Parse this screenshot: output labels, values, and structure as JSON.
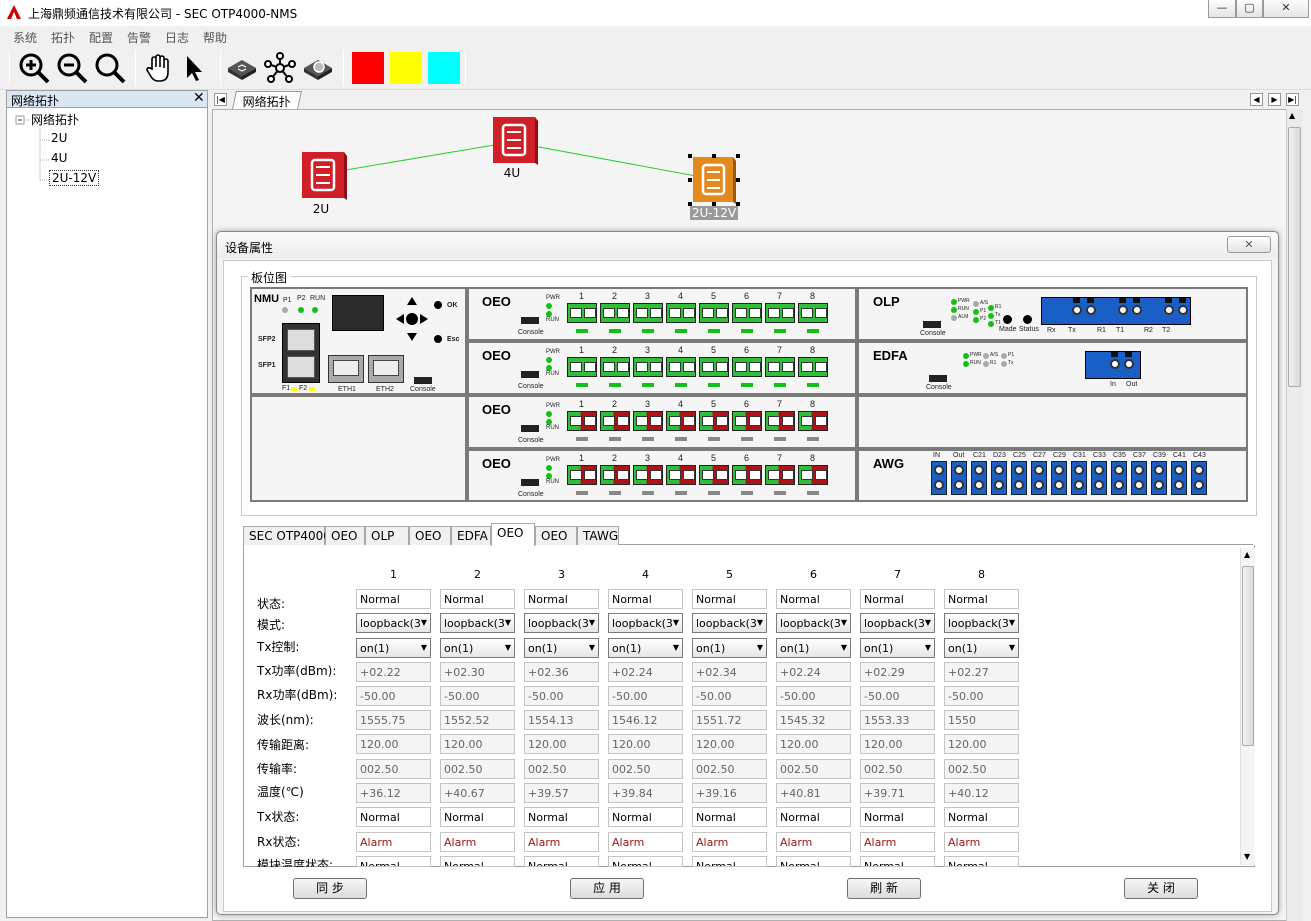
{
  "window": {
    "title": "上海鼎频通信技术有限公司 - SEC OTP4000-NMS"
  },
  "menu": [
    "系统",
    "拓扑",
    "配置",
    "告警",
    "日志",
    "帮助"
  ],
  "toolbar": {
    "tools": [
      "zoom-in-icon",
      "zoom-out-icon",
      "zoom-fit-icon",
      "hand-icon",
      "pointer-icon",
      "router-icon",
      "topology-icon",
      "search-device-icon"
    ],
    "colors": [
      "#ff0000",
      "#ffff00",
      "#00ffff"
    ]
  },
  "tree": {
    "panel_title": "网络拓扑",
    "root": "网络拓扑",
    "children": [
      "2U",
      "4U",
      "2U-12V"
    ]
  },
  "main": {
    "tab": "网络拓扑",
    "nodes": [
      "2U",
      "4U",
      "2U-12V"
    ]
  },
  "dialog": {
    "title": "设备属性",
    "board_group": "板位图",
    "slots": {
      "nmu": {
        "name": "NMU",
        "leds": [
          "P1",
          "P2",
          "RUN"
        ],
        "ports": [
          "SFP2",
          "SFP1",
          "ETH1",
          "ETH2",
          "Console"
        ],
        "keys": [
          "OK",
          "Esc"
        ],
        "sfp_labels": [
          "F1",
          "F2"
        ]
      },
      "oeo": {
        "name": "OEO",
        "leds": [
          "PWR",
          "RUN"
        ],
        "console": "Console",
        "ports": [
          "1",
          "2",
          "3",
          "4",
          "5",
          "6",
          "7",
          "8"
        ]
      },
      "olp": {
        "name": "OLP",
        "console": "Console",
        "leds": [
          "PWR",
          "RUN",
          "ALM",
          "A/S",
          "P1",
          "P2",
          "R1",
          "Tx",
          "T1"
        ],
        "labels": [
          "Made",
          "Status"
        ],
        "ports": [
          "Rx",
          "Tx",
          "R1",
          "T1",
          "R2",
          "T2"
        ]
      },
      "edfa": {
        "name": "EDFA",
        "console": "Console",
        "leds": [
          "PWR",
          "RUN",
          "A/S",
          "R1",
          "P1",
          "Tx"
        ],
        "ports": [
          "In",
          "Out"
        ]
      },
      "awg": {
        "name": "AWG",
        "ports": [
          "IN",
          "Out",
          "C21",
          "D23",
          "C25",
          "C27",
          "C29",
          "C31",
          "C33",
          "C35",
          "C37",
          "C39",
          "C41",
          "C43"
        ]
      }
    },
    "tabs": [
      "SEC OTP4000",
      "OEO",
      "OLP",
      "OEO",
      "EDFA",
      "OEO",
      "OEO",
      "TAWG"
    ],
    "active_tab": 5,
    "columns": [
      "1",
      "2",
      "3",
      "4",
      "5",
      "6",
      "7",
      "8"
    ],
    "rows": {
      "status": {
        "label": "状态:",
        "values": [
          "Normal",
          "Normal",
          "Normal",
          "Normal",
          "Normal",
          "Normal",
          "Normal",
          "Normal"
        ]
      },
      "mode": {
        "label": "模式:",
        "values": [
          "loopback(3",
          "loopback(3",
          "loopback(3",
          "loopback(3",
          "loopback(3",
          "loopback(3",
          "loopback(3",
          "loopback(3"
        ]
      },
      "tx_ctrl": {
        "label": "Tx控制:",
        "values": [
          "on(1)",
          "on(1)",
          "on(1)",
          "on(1)",
          "on(1)",
          "on(1)",
          "on(1)",
          "on(1)"
        ]
      },
      "tx_power": {
        "label": "Tx功率(dBm):",
        "values": [
          "+02.22",
          "+02.30",
          "+02.36",
          "+02.24",
          "+02.34",
          "+02.24",
          "+02.29",
          "+02.27"
        ]
      },
      "rx_power": {
        "label": "Rx功率(dBm):",
        "values": [
          "-50.00",
          "-50.00",
          "-50.00",
          "-50.00",
          "-50.00",
          "-50.00",
          "-50.00",
          "-50.00"
        ]
      },
      "wavelength": {
        "label": "波长(nm):",
        "values": [
          "1555.75",
          "1552.52",
          "1554.13",
          "1546.12",
          "1551.72",
          "1545.32",
          "1553.33",
          "1550"
        ]
      },
      "distance": {
        "label": "传输距离:",
        "values": [
          "120.00",
          "120.00",
          "120.00",
          "120.00",
          "120.00",
          "120.00",
          "120.00",
          "120.00"
        ]
      },
      "rate": {
        "label": "传输率:",
        "values": [
          "002.50",
          "002.50",
          "002.50",
          "002.50",
          "002.50",
          "002.50",
          "002.50",
          "002.50"
        ]
      },
      "temp": {
        "label": "温度(℃)",
        "values": [
          "+36.12",
          "+40.67",
          "+39.57",
          "+39.84",
          "+39.16",
          "+40.81",
          "+39.71",
          "+40.12"
        ]
      },
      "tx_status": {
        "label": "Tx状态:",
        "values": [
          "Normal",
          "Normal",
          "Normal",
          "Normal",
          "Normal",
          "Normal",
          "Normal",
          "Normal"
        ]
      },
      "rx_status": {
        "label": "Rx状态:",
        "values": [
          "Alarm",
          "Alarm",
          "Alarm",
          "Alarm",
          "Alarm",
          "Alarm",
          "Alarm",
          "Alarm"
        ]
      },
      "module_temp": {
        "label": "模块温度状态:",
        "values": [
          "Normal",
          "Normal",
          "Normal",
          "Normal",
          "Normal",
          "Normal",
          "Normal",
          "Normal"
        ]
      }
    },
    "buttons": {
      "sync": "同 步",
      "apply": "应 用",
      "refresh": "刷 新",
      "close": "关 闭"
    }
  }
}
